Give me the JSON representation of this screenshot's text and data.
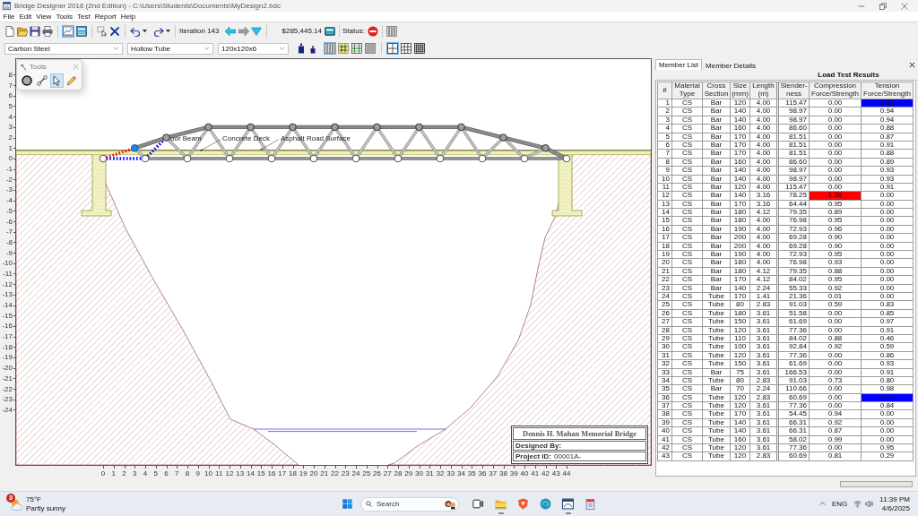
{
  "window": {
    "title": "Bridge Designer 2016 (2nd Edition) - C:\\Users\\Students\\Documents\\MyDesign2.bdc"
  },
  "menu": [
    "File",
    "Edit",
    "View",
    "Tools",
    "Test",
    "Report",
    "Help"
  ],
  "toolbar": {
    "view_toggles": [
      {
        "selected": true
      },
      {
        "selected": false
      }
    ],
    "iteration": "Iteration 143",
    "cost": "$285,445.14",
    "status_label": "Status:"
  },
  "member_bar": {
    "material": "Carbon Steel",
    "section": "Hollow Tube",
    "size": "120x120x6",
    "display_toggles": [
      {
        "selected": true
      },
      {
        "selected": false
      },
      {
        "selected": false
      },
      {
        "selected": false
      }
    ],
    "grid_options": [
      {
        "selected": true
      },
      {
        "selected": false
      },
      {
        "selected": false
      }
    ]
  },
  "tools_palette": {
    "title": "Tools",
    "tools": [
      {
        "selected": false
      },
      {
        "selected": false
      },
      {
        "selected": true
      },
      {
        "selected": false
      }
    ]
  },
  "drawing": {
    "labels": [
      "oor Beam",
      "Concrete Deck",
      "Asphalt Road Surface"
    ],
    "top_joints": [
      {
        "selected": true
      },
      {
        "selected": false
      },
      {
        "selected": false
      },
      {
        "selected": false
      },
      {
        "selected": false
      },
      {
        "selected": false
      },
      {
        "selected": false
      },
      {
        "selected": false
      },
      {
        "selected": false
      },
      {
        "selected": false
      },
      {
        "selected": false
      }
    ],
    "y_ruler": [
      "8",
      "7",
      "6",
      "5",
      "4",
      "3",
      "2",
      "1",
      "0",
      "-1",
      "-2",
      "-3",
      "-4",
      "-5",
      "-6",
      "-7",
      "-8",
      "-9",
      "-10",
      "-11",
      "-12",
      "-13",
      "-14",
      "-15",
      "-16",
      "-17",
      "-18",
      "-19",
      "-20",
      "-21",
      "-22",
      "-23",
      "-24"
    ],
    "x_ruler": [
      "0",
      "1",
      "2",
      "3",
      "4",
      "5",
      "6",
      "7",
      "8",
      "9",
      "10",
      "11",
      "12",
      "13",
      "14",
      "15",
      "16",
      "17",
      "18",
      "19",
      "20",
      "21",
      "22",
      "23",
      "24",
      "25",
      "26",
      "27",
      "28",
      "29",
      "30",
      "31",
      "32",
      "33",
      "34",
      "35",
      "36",
      "37",
      "38",
      "39",
      "40",
      "41",
      "42",
      "43",
      "44"
    ]
  },
  "title_block": {
    "bridge_name": "Dennis H. Mahan Memorial Bridge",
    "designed_by_label": "Designed By:",
    "project_id_label": "Project ID:",
    "project_id": "00001A-"
  },
  "panel": {
    "tabs": [
      {
        "label": "Member List",
        "selected": true
      },
      {
        "label": "Member Details",
        "selected": false
      }
    ],
    "title": "Load Test Results",
    "columns": [
      "#",
      "Material Type",
      "Cross Section",
      "Size (mm)",
      "Length (m)",
      "Slender-ness",
      "Compression Force/Strength",
      "Tension Force/Strength"
    ],
    "rows": [
      {
        "cells": [
          "1",
          "CS",
          "Bar",
          "120",
          "4.00",
          "115.47",
          "0.00",
          "1.38"
        ],
        "compression_fail": false,
        "tension_fail": true
      },
      {
        "cells": [
          "2",
          "CS",
          "Bar",
          "140",
          "4.00",
          "98.97",
          "0.00",
          "0.94"
        ],
        "compression_fail": false,
        "tension_fail": false
      },
      {
        "cells": [
          "3",
          "CS",
          "Bar",
          "140",
          "4.00",
          "98.97",
          "0.00",
          "0.94"
        ],
        "compression_fail": false,
        "tension_fail": false
      },
      {
        "cells": [
          "4",
          "CS",
          "Bar",
          "160",
          "4.00",
          "86.60",
          "0.00",
          "0.88"
        ],
        "compression_fail": false,
        "tension_fail": false
      },
      {
        "cells": [
          "5",
          "CS",
          "Bar",
          "170",
          "4.00",
          "81.51",
          "0.00",
          "0.87"
        ],
        "compression_fail": false,
        "tension_fail": false
      },
      {
        "cells": [
          "6",
          "CS",
          "Bar",
          "170",
          "4.00",
          "81.51",
          "0.00",
          "0.91"
        ],
        "compression_fail": false,
        "tension_fail": false
      },
      {
        "cells": [
          "7",
          "CS",
          "Bar",
          "170",
          "4.00",
          "81.51",
          "0.00",
          "0.88"
        ],
        "compression_fail": false,
        "tension_fail": false
      },
      {
        "cells": [
          "8",
          "CS",
          "Bar",
          "160",
          "4.00",
          "86.60",
          "0.00",
          "0.89"
        ],
        "compression_fail": false,
        "tension_fail": false
      },
      {
        "cells": [
          "9",
          "CS",
          "Bar",
          "140",
          "4.00",
          "98.97",
          "0.00",
          "0.93"
        ],
        "compression_fail": false,
        "tension_fail": false
      },
      {
        "cells": [
          "10",
          "CS",
          "Bar",
          "140",
          "4.00",
          "98.97",
          "0.00",
          "0.93"
        ],
        "compression_fail": false,
        "tension_fail": false
      },
      {
        "cells": [
          "11",
          "CS",
          "Bar",
          "120",
          "4.00",
          "115.47",
          "0.00",
          "0.91"
        ],
        "compression_fail": false,
        "tension_fail": false
      },
      {
        "cells": [
          "12",
          "CS",
          "Bar",
          "140",
          "3.16",
          "78.25",
          "1.56",
          "0.00"
        ],
        "compression_fail": true,
        "tension_fail": false
      },
      {
        "cells": [
          "13",
          "CS",
          "Bar",
          "170",
          "3.16",
          "64.44",
          "0.95",
          "0.00"
        ],
        "compression_fail": false,
        "tension_fail": false
      },
      {
        "cells": [
          "14",
          "CS",
          "Bar",
          "180",
          "4.12",
          "79.35",
          "0.89",
          "0.00"
        ],
        "compression_fail": false,
        "tension_fail": false
      },
      {
        "cells": [
          "15",
          "CS",
          "Bar",
          "180",
          "4.00",
          "76.98",
          "0.95",
          "0.00"
        ],
        "compression_fail": false,
        "tension_fail": false
      },
      {
        "cells": [
          "16",
          "CS",
          "Bar",
          "190",
          "4.00",
          "72.93",
          "0.96",
          "0.00"
        ],
        "compression_fail": false,
        "tension_fail": false
      },
      {
        "cells": [
          "17",
          "CS",
          "Bar",
          "200",
          "4.00",
          "69.28",
          "0.90",
          "0.00"
        ],
        "compression_fail": false,
        "tension_fail": false
      },
      {
        "cells": [
          "18",
          "CS",
          "Bar",
          "200",
          "4.00",
          "69.28",
          "0.90",
          "0.00"
        ],
        "compression_fail": false,
        "tension_fail": false
      },
      {
        "cells": [
          "19",
          "CS",
          "Bar",
          "190",
          "4.00",
          "72.93",
          "0.95",
          "0.00"
        ],
        "compression_fail": false,
        "tension_fail": false
      },
      {
        "cells": [
          "20",
          "CS",
          "Bar",
          "180",
          "4.00",
          "76.98",
          "0.93",
          "0.00"
        ],
        "compression_fail": false,
        "tension_fail": false
      },
      {
        "cells": [
          "21",
          "CS",
          "Bar",
          "180",
          "4.12",
          "79.35",
          "0.88",
          "0.00"
        ],
        "compression_fail": false,
        "tension_fail": false
      },
      {
        "cells": [
          "22",
          "CS",
          "Bar",
          "170",
          "4.12",
          "84.02",
          "0.95",
          "0.00"
        ],
        "compression_fail": false,
        "tension_fail": false
      },
      {
        "cells": [
          "23",
          "CS",
          "Bar",
          "140",
          "2.24",
          "55.33",
          "0.92",
          "0.00"
        ],
        "compression_fail": false,
        "tension_fail": false
      },
      {
        "cells": [
          "24",
          "CS",
          "Tube",
          "170",
          "1.41",
          "21.36",
          "0.01",
          "0.00"
        ],
        "compression_fail": false,
        "tension_fail": false
      },
      {
        "cells": [
          "25",
          "CS",
          "Tube",
          "80",
          "2.83",
          "91.03",
          "0.59",
          "0.83"
        ],
        "compression_fail": false,
        "tension_fail": false
      },
      {
        "cells": [
          "26",
          "CS",
          "Tube",
          "180",
          "3.61",
          "51.58",
          "0.00",
          "0.85"
        ],
        "compression_fail": false,
        "tension_fail": false
      },
      {
        "cells": [
          "27",
          "CS",
          "Tube",
          "150",
          "3.61",
          "61.69",
          "0.00",
          "0.97"
        ],
        "compression_fail": false,
        "tension_fail": false
      },
      {
        "cells": [
          "28",
          "CS",
          "Tube",
          "120",
          "3.61",
          "77.36",
          "0.00",
          "0.91"
        ],
        "compression_fail": false,
        "tension_fail": false
      },
      {
        "cells": [
          "29",
          "CS",
          "Tube",
          "110",
          "3.61",
          "84.02",
          "0.88",
          "0.46"
        ],
        "compression_fail": false,
        "tension_fail": false
      },
      {
        "cells": [
          "30",
          "CS",
          "Tube",
          "100",
          "3.61",
          "92.84",
          "0.92",
          "0.59"
        ],
        "compression_fail": false,
        "tension_fail": false
      },
      {
        "cells": [
          "31",
          "CS",
          "Tube",
          "120",
          "3.61",
          "77.36",
          "0.00",
          "0.86"
        ],
        "compression_fail": false,
        "tension_fail": false
      },
      {
        "cells": [
          "32",
          "CS",
          "Tube",
          "150",
          "3.61",
          "61.69",
          "0.00",
          "0.93"
        ],
        "compression_fail": false,
        "tension_fail": false
      },
      {
        "cells": [
          "33",
          "CS",
          "Bar",
          "75",
          "3.61",
          "166.53",
          "0.00",
          "0.91"
        ],
        "compression_fail": false,
        "tension_fail": false
      },
      {
        "cells": [
          "34",
          "CS",
          "Tube",
          "80",
          "2.83",
          "91.03",
          "0.73",
          "0.80"
        ],
        "compression_fail": false,
        "tension_fail": false
      },
      {
        "cells": [
          "35",
          "CS",
          "Bar",
          "70",
          "2.24",
          "110.66",
          "0.00",
          "0.98"
        ],
        "compression_fail": false,
        "tension_fail": false
      },
      {
        "cells": [
          "36",
          "CS",
          "Tube",
          "120",
          "2.83",
          "60.69",
          "0.00",
          "1.27"
        ],
        "compression_fail": false,
        "tension_fail": true
      },
      {
        "cells": [
          "37",
          "CS",
          "Tube",
          "120",
          "3.61",
          "77.36",
          "0.00",
          "0.84"
        ],
        "compression_fail": false,
        "tension_fail": false
      },
      {
        "cells": [
          "38",
          "CS",
          "Tube",
          "170",
          "3.61",
          "54.45",
          "0.94",
          "0.00"
        ],
        "compression_fail": false,
        "tension_fail": false
      },
      {
        "cells": [
          "39",
          "CS",
          "Tube",
          "140",
          "3.61",
          "66.31",
          "0.92",
          "0.00"
        ],
        "compression_fail": false,
        "tension_fail": false
      },
      {
        "cells": [
          "40",
          "CS",
          "Tube",
          "140",
          "3.61",
          "66.31",
          "0.87",
          "0.00"
        ],
        "compression_fail": false,
        "tension_fail": false
      },
      {
        "cells": [
          "41",
          "CS",
          "Tube",
          "160",
          "3.61",
          "58.02",
          "0.99",
          "0.00"
        ],
        "compression_fail": false,
        "tension_fail": false
      },
      {
        "cells": [
          "42",
          "CS",
          "Tube",
          "120",
          "3.61",
          "77.36",
          "0.00",
          "0.95"
        ],
        "compression_fail": false,
        "tension_fail": false
      },
      {
        "cells": [
          "43",
          "CS",
          "Tube",
          "120",
          "2.83",
          "60.69",
          "0.81",
          "0.29"
        ],
        "compression_fail": false,
        "tension_fail": false
      }
    ]
  },
  "taskbar": {
    "weather": {
      "badge": "3",
      "temperature": "75°F",
      "condition": "Partly sunny"
    },
    "search": {
      "placeholder": "Search"
    },
    "apps": [
      {
        "running": false
      },
      {
        "running": true
      },
      {
        "running": false
      },
      {
        "running": false
      },
      {
        "running": true
      },
      {
        "running": false
      }
    ],
    "language": "ENG",
    "time": "11:39 PM",
    "date": "4/6/2025"
  }
}
